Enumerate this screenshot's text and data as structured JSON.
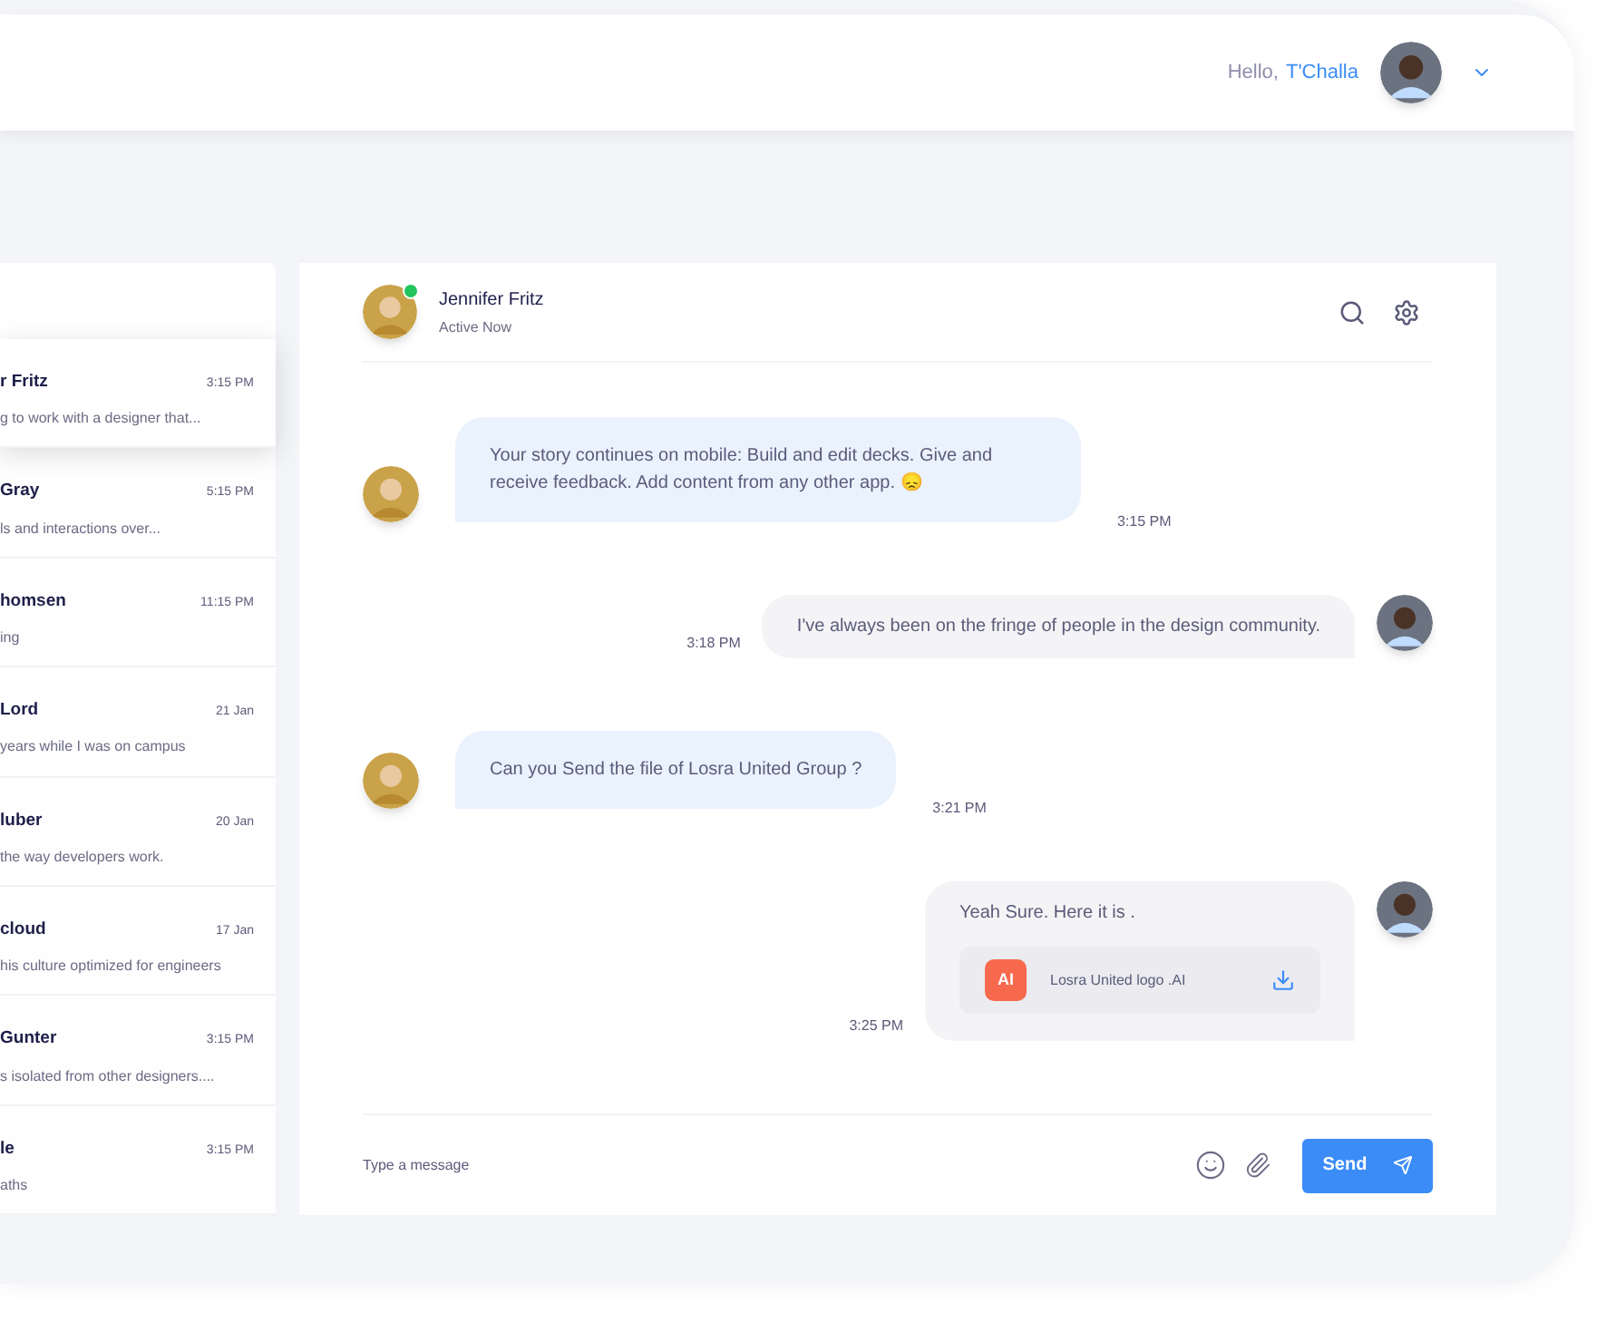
{
  "header": {
    "greeting": "Hello,",
    "user_name": "T'Challa"
  },
  "conversations": [
    {
      "name": "r Fritz",
      "time": "3:15 PM",
      "preview": "g to work with a designer that...",
      "selected": true
    },
    {
      "name": "Gray",
      "time": "5:15 PM",
      "preview": "ls and interactions over...",
      "selected": false
    },
    {
      "name": "homsen",
      "time": "11:15 PM",
      "preview": "ing",
      "selected": false
    },
    {
      "name": "Lord",
      "time": "21 Jan",
      "preview": "years while I was on campus",
      "selected": false
    },
    {
      "name": "luber",
      "time": "20 Jan",
      "preview": "the way developers work.",
      "selected": false
    },
    {
      "name": "cloud",
      "time": "17 Jan",
      "preview": "his culture optimized for engineers",
      "selected": false
    },
    {
      "name": "Gunter",
      "time": "3:15 PM",
      "preview": "s isolated from other designers....",
      "selected": false
    },
    {
      "name": "le",
      "time": "3:15 PM",
      "preview": "aths",
      "selected": false
    }
  ],
  "chat": {
    "contact_name": "Jennifer Fritz",
    "status": "Active Now",
    "online": true,
    "messages": [
      {
        "kind": "incoming",
        "text": "Your story continues on mobile: Build and edit decks. Give and receive feedback. Add content from any other app. 😞",
        "time": "3:15 PM"
      },
      {
        "kind": "outgoing",
        "text": "I've always been on the fringe of people in the design community.",
        "time": "3:18 PM"
      },
      {
        "kind": "incoming",
        "text": "Can you Send the file of Losra United Group ?",
        "time": "3:21 PM"
      },
      {
        "kind": "outgoing",
        "text": "Yeah Sure. Here it is .",
        "time": "3:25 PM",
        "attachment": {
          "badge": "AI",
          "file_name": "Losra United logo .AI"
        }
      }
    ],
    "input": {
      "placeholder": "Type a message"
    },
    "send_button": "Send"
  }
}
